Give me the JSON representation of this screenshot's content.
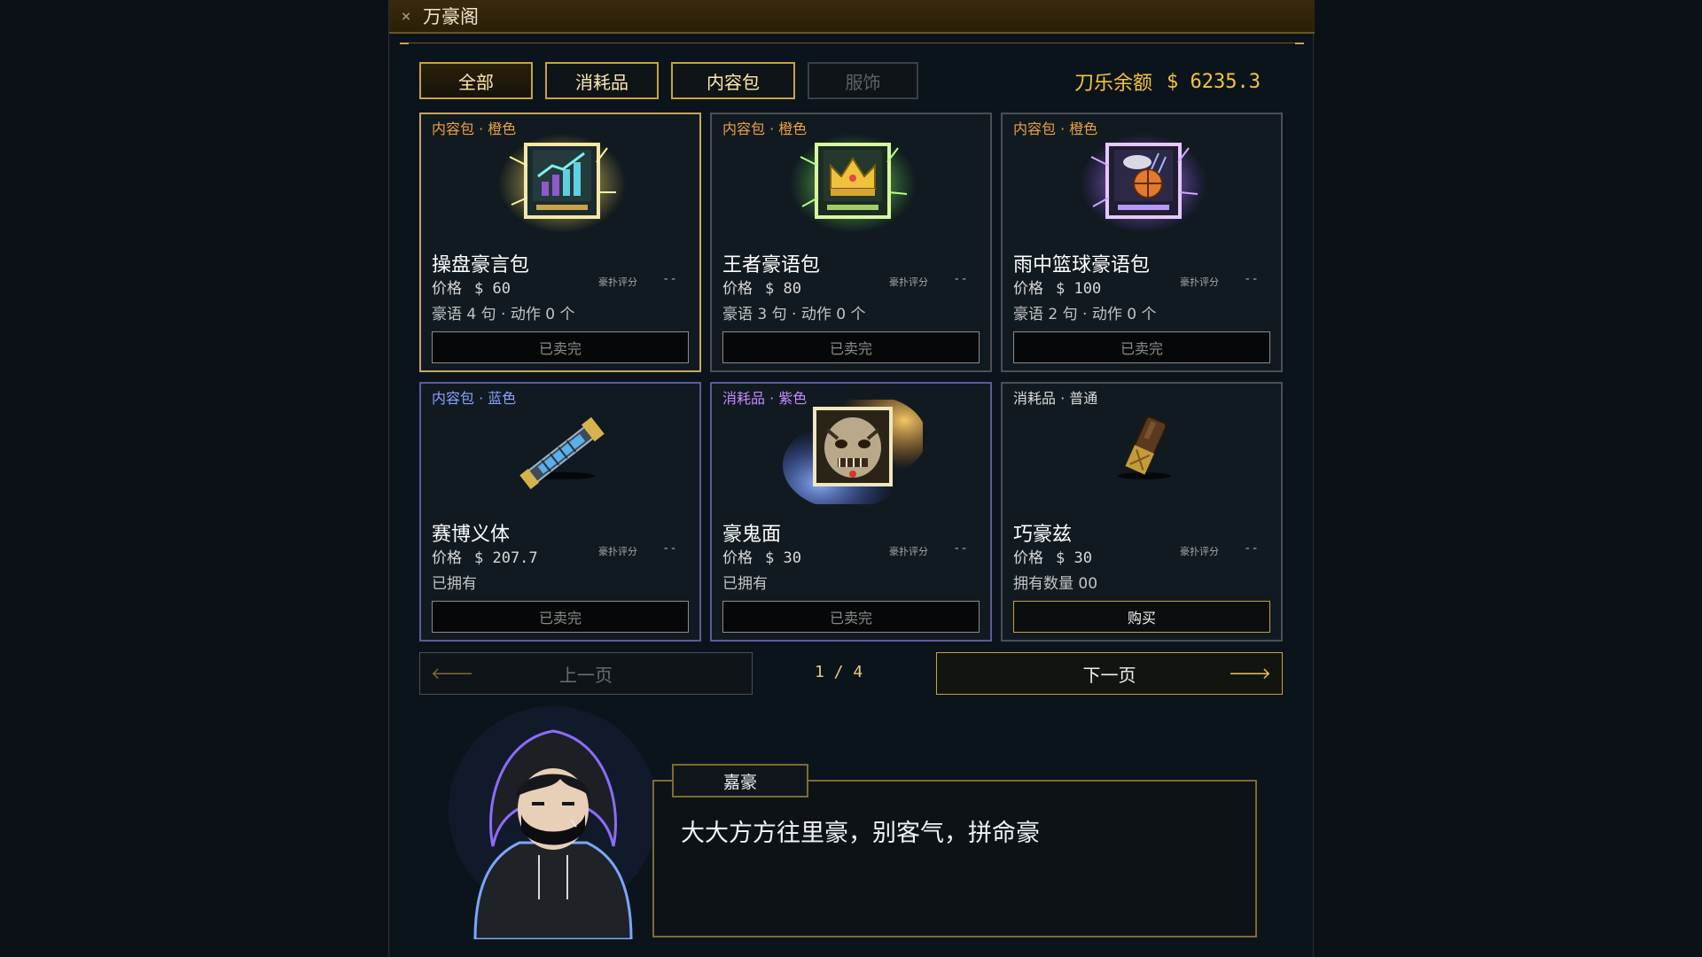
{
  "window": {
    "title": "万豪阁",
    "close_glyph": "×"
  },
  "tabs": [
    {
      "label": "全部",
      "state": "active"
    },
    {
      "label": "消耗品",
      "state": "normal"
    },
    {
      "label": "内容包",
      "state": "normal"
    },
    {
      "label": "服饰",
      "state": "disabled"
    }
  ],
  "balance": {
    "label": "刀乐余额",
    "value": "$ 6235.3"
  },
  "cards": [
    {
      "tag": "内容包 · 橙色",
      "name": "操盘豪言包",
      "price_label": "价格",
      "price": "$ 60",
      "rating_label": "豪扑评分",
      "rating": "--",
      "info": "豪语 4 句  ·  动作 0 个",
      "action": "已卖完",
      "icon": "stock-chart-icon"
    },
    {
      "tag": "内容包 · 橙色",
      "name": "王者豪语包",
      "price_label": "价格",
      "price": "$ 80",
      "rating_label": "豪扑评分",
      "rating": "--",
      "info": "豪语 3 句  ·  动作 0 个",
      "action": "已卖完",
      "icon": "crown-icon"
    },
    {
      "tag": "内容包 · 橙色",
      "name": "雨中篮球豪语包",
      "price_label": "价格",
      "price": "$ 100",
      "rating_label": "豪扑评分",
      "rating": "--",
      "info": "豪语 2 句  ·  动作 0 个",
      "action": "已卖完",
      "icon": "basketball-rain-icon"
    },
    {
      "tag": "内容包 · 蓝色",
      "name": "赛博义体",
      "price_label": "价格",
      "price": "$ 207.7",
      "rating_label": "豪扑评分",
      "rating": "--",
      "info": "已拥有",
      "action": "已卖完",
      "icon": "cyber-arm-icon"
    },
    {
      "tag": "消耗品 · 紫色",
      "name": "豪鬼面",
      "price_label": "价格",
      "price": "$ 30",
      "rating_label": "豪扑评分",
      "rating": "--",
      "info": "已拥有",
      "action": "已卖完",
      "icon": "oni-mask-icon"
    },
    {
      "tag": "消耗品 · 普通",
      "name": "巧豪兹",
      "price_label": "价格",
      "price": "$ 30",
      "rating_label": "豪扑评分",
      "rating": "--",
      "info": "拥有数量  00",
      "action": "购买",
      "icon": "chocolate-bar-icon"
    }
  ],
  "pager": {
    "prev": "上一页",
    "next": "下一页",
    "page": "1 / 4",
    "prev_arrow": "🡐",
    "next_arrow": "🡒"
  },
  "dialogue": {
    "speaker": "嘉豪",
    "text": "大大方方往里豪，别客气，拼命豪"
  },
  "colors": {
    "gold": "#c7a23e",
    "balance": "#f4c437",
    "orange_tag": "#e9a13d",
    "blue_tag": "#8aa0ff",
    "purple_tag": "#c28bff"
  }
}
